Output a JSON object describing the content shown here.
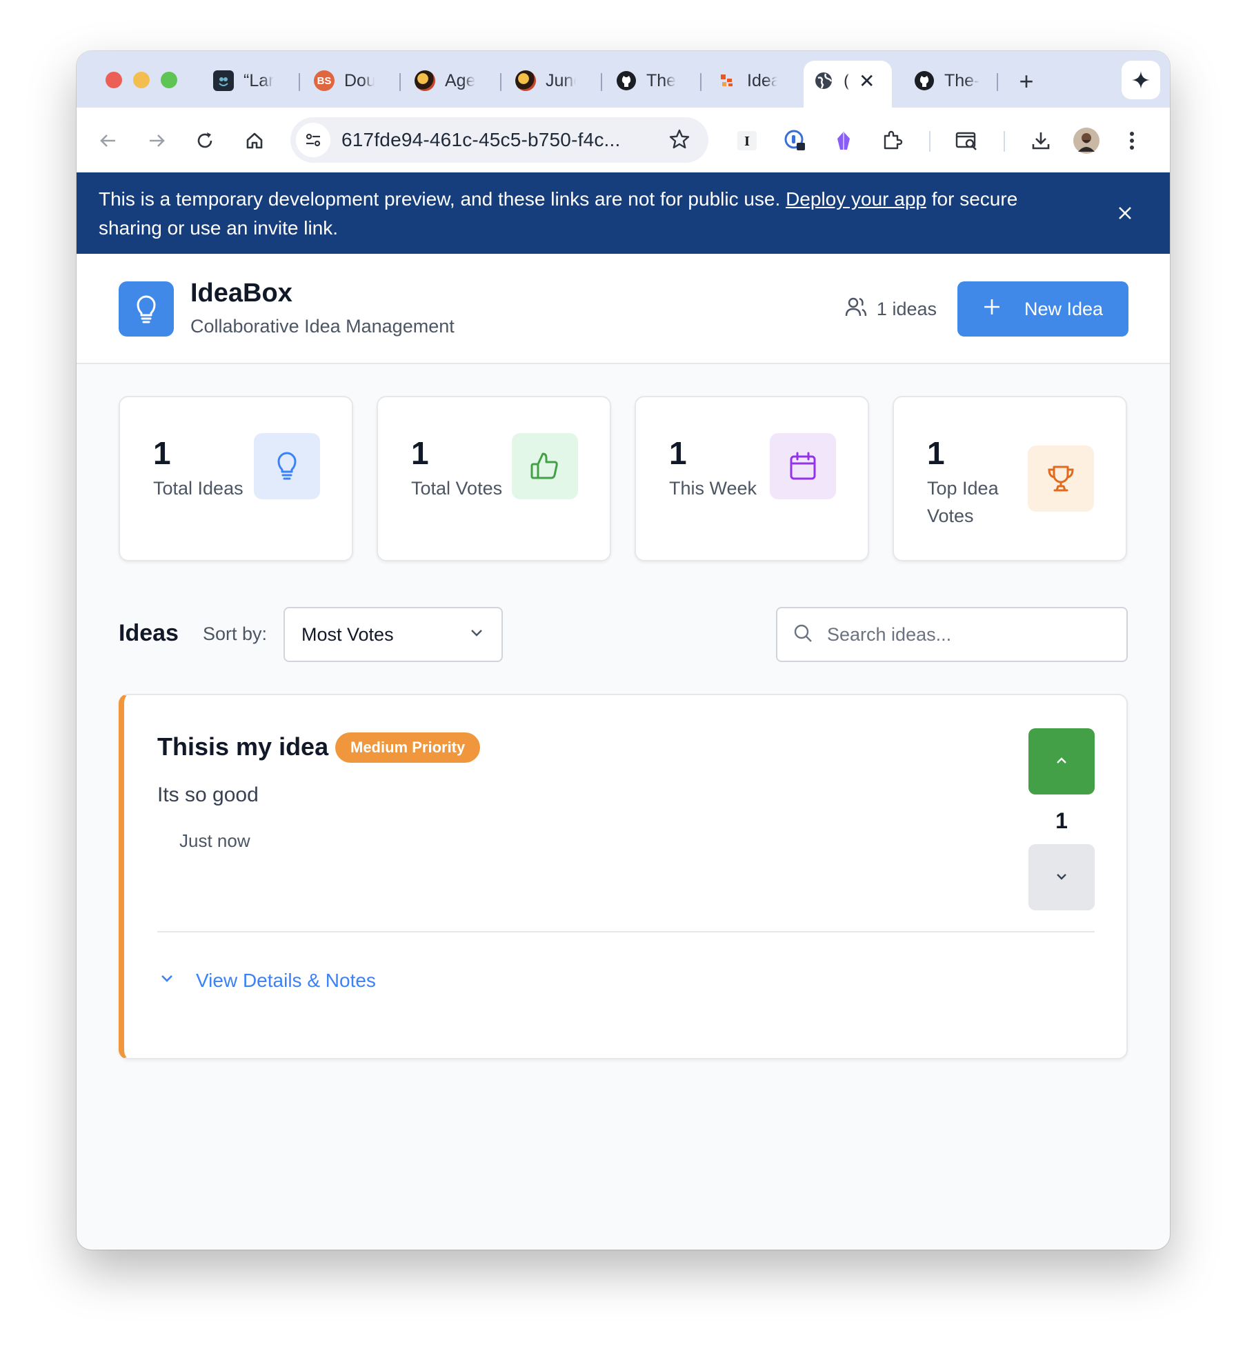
{
  "browser": {
    "tabs": [
      {
        "title": "“Lan",
        "icon": "owl-icon"
      },
      {
        "title": "Doul",
        "icon": "bs-logo-icon"
      },
      {
        "title": "Ager",
        "icon": "orb-icon"
      },
      {
        "title": "June",
        "icon": "orb-icon"
      },
      {
        "title": "The",
        "icon": "github-icon"
      },
      {
        "title": "Ideal",
        "icon": "ideabox-favicon"
      },
      {
        "title": "(",
        "icon": "globe-icon",
        "active": true
      },
      {
        "title": "The-",
        "icon": "github-icon"
      }
    ],
    "url": "617fde94-461c-45c5-b750-f4c...",
    "colors": {
      "tabstrip": "#dbe3f4",
      "active_tab": "#ffffff"
    }
  },
  "banner": {
    "text_before": "This is a temporary development preview, and these links are not for public use.",
    "link_text": "Deploy your app",
    "text_after": "for secure sharing or use an invite link.",
    "color": "#173e7c"
  },
  "header": {
    "title": "IdeaBox",
    "subtitle": "Collaborative Idea Management",
    "ideas_count": "1 ideas",
    "new_button": "New Idea",
    "accent": "#4189e9"
  },
  "stats": [
    {
      "value": "1",
      "label": "Total Ideas",
      "icon": "lightbulb-icon",
      "bg": "#e1ebfb",
      "fg": "#3b82f6"
    },
    {
      "value": "1",
      "label": "Total Votes",
      "icon": "thumbs-up-icon",
      "bg": "#e3f7e8",
      "fg": "#43a047"
    },
    {
      "value": "1",
      "label": "This Week",
      "icon": "calendar-icon",
      "bg": "#f2e6fb",
      "fg": "#9333ea"
    },
    {
      "value": "1",
      "label": "Top Idea Votes",
      "icon": "trophy-icon",
      "bg": "#fdf0e1",
      "fg": "#e06b1f"
    }
  ],
  "ideas_section": {
    "heading": "Ideas",
    "sort_label": "Sort by:",
    "sort_value": "Most Votes",
    "search_placeholder": "Search ideas..."
  },
  "ideas": [
    {
      "title": "Thisis my idea",
      "priority": "Medium Priority",
      "priority_color": "#f0973e",
      "description": "Its so good",
      "time": "Just now",
      "votes": "1",
      "details_label": "View Details & Notes"
    }
  ]
}
